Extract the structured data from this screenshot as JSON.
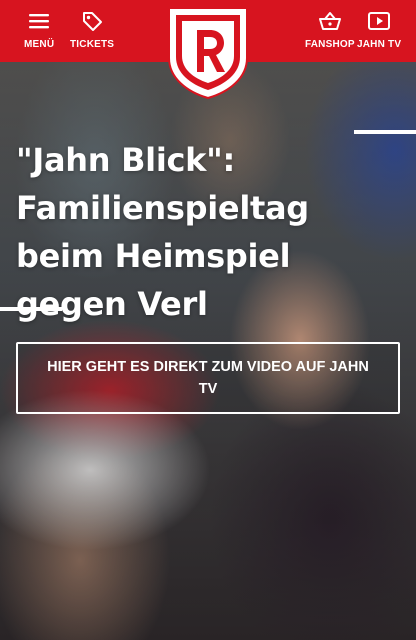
{
  "nav": {
    "menu_label": "MENÜ",
    "tickets_label": "TICKETS",
    "fanshop_label": "FANSHOP",
    "jahntv_label": "JAHN TV"
  },
  "crest": {
    "letter": "R"
  },
  "hero": {
    "headline": "\"Jahn Blick\": Familienspieltag beim Heimspiel gegen Verl",
    "cta_label": "HIER GEHT ES DIREKT ZUM VIDEO AUF JAHN TV"
  },
  "colors": {
    "brand_red": "#d7141f",
    "text": "#ffffff"
  },
  "icons": {
    "menu": "hamburger-icon",
    "tickets": "ticket-tag-icon",
    "fanshop": "shopping-basket-icon",
    "jahntv": "play-video-icon"
  }
}
